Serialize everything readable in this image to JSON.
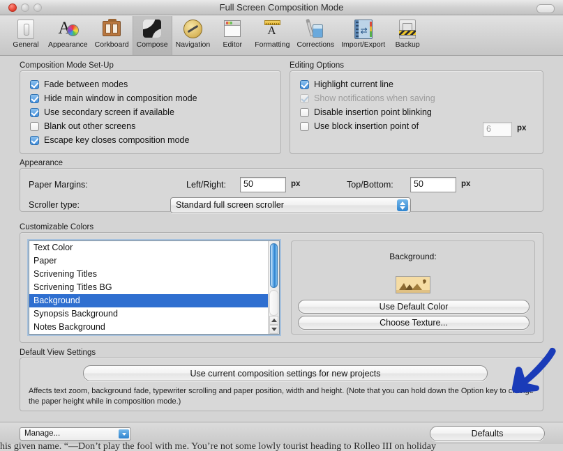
{
  "window": {
    "title": "Full Screen Composition Mode",
    "traffic_lights": [
      "close",
      "minimize",
      "zoom"
    ],
    "toolbar_toggle": "toolbar-pill"
  },
  "toolbar": {
    "items": [
      {
        "label": "General",
        "icon": "switch-icon",
        "selected": false
      },
      {
        "label": "Appearance",
        "icon": "color-wheel-icon",
        "selected": false
      },
      {
        "label": "Corkboard",
        "icon": "corkboard-icon",
        "selected": false
      },
      {
        "label": "Compose",
        "icon": "compose-icon",
        "selected": true
      },
      {
        "label": "Navigation",
        "icon": "compass-icon",
        "selected": false
      },
      {
        "label": "Editor",
        "icon": "document-icon",
        "selected": false
      },
      {
        "label": "Formatting",
        "icon": "ruler-a-icon",
        "selected": false
      },
      {
        "label": "Corrections",
        "icon": "brush-bottle-icon",
        "selected": false
      },
      {
        "label": "Import/Export",
        "icon": "exchange-book-icon",
        "selected": false
      },
      {
        "label": "Backup",
        "icon": "drive-hazard-icon",
        "selected": false
      }
    ]
  },
  "setup_group": {
    "title": "Composition Mode Set-Up",
    "checkboxes": [
      {
        "label": "Fade between modes",
        "checked": true,
        "enabled": true
      },
      {
        "label": "Hide main window in composition mode",
        "checked": true,
        "enabled": true
      },
      {
        "label": "Use secondary screen if available",
        "checked": true,
        "enabled": true
      },
      {
        "label": "Blank out other screens",
        "checked": false,
        "enabled": true
      },
      {
        "label": "Escape key closes composition mode",
        "checked": true,
        "enabled": true
      }
    ]
  },
  "editing_group": {
    "title": "Editing Options",
    "checkboxes": [
      {
        "label": "Highlight current line",
        "checked": true,
        "enabled": true
      },
      {
        "label": "Show notifications when saving",
        "checked": true,
        "enabled": false
      },
      {
        "label": "Disable insertion point blinking",
        "checked": false,
        "enabled": true
      },
      {
        "label": "Use block insertion point of",
        "checked": false,
        "enabled": true
      }
    ],
    "block_size_value": "6",
    "block_size_unit": "px"
  },
  "appearance_group": {
    "title": "Appearance",
    "paper_margins_label": "Paper Margins:",
    "left_right_label": "Left/Right:",
    "left_right_value": "50",
    "left_right_unit": "px",
    "top_bottom_label": "Top/Bottom:",
    "top_bottom_value": "50",
    "top_bottom_unit": "px",
    "scroller_label": "Scroller type:",
    "scroller_value": "Standard full screen scroller"
  },
  "colors_group": {
    "title": "Customizable Colors",
    "list_items": [
      {
        "label": "Text Color",
        "selected": false
      },
      {
        "label": "Paper",
        "selected": false
      },
      {
        "label": "Scrivening Titles",
        "selected": false
      },
      {
        "label": "Scrivening Titles BG",
        "selected": false
      },
      {
        "label": "Background",
        "selected": true
      },
      {
        "label": "Synopsis Background",
        "selected": false
      },
      {
        "label": "Notes Background",
        "selected": false
      }
    ],
    "detail_label": "Background:",
    "swatch_name": "texture-swatch",
    "use_default_color_button": "Use Default Color",
    "choose_texture_button": "Choose Texture..."
  },
  "default_view_group": {
    "title": "Default View Settings",
    "button_label": "Use current composition settings for new projects",
    "note": "Affects text zoom, background fade, typewriter scrolling and paper position, width and height. (Note that you can hold down the Option key to change the paper height while in composition mode.)"
  },
  "bottom_bar": {
    "manage_label": "Manage...",
    "defaults_label": "Defaults"
  },
  "background_document": {
    "text": "his given name. “—Don’t play the fool with me. You’re not some lowly tourist heading to Rolleo III on holiday"
  },
  "annotation": {
    "arrow_color": "#1a3bb8",
    "name": "blue-arrow-annotation"
  },
  "colors": {
    "selection_blue": "#2f6fd0",
    "window_bg": "#d4d4d4",
    "title_text": "#2b2b2b"
  }
}
